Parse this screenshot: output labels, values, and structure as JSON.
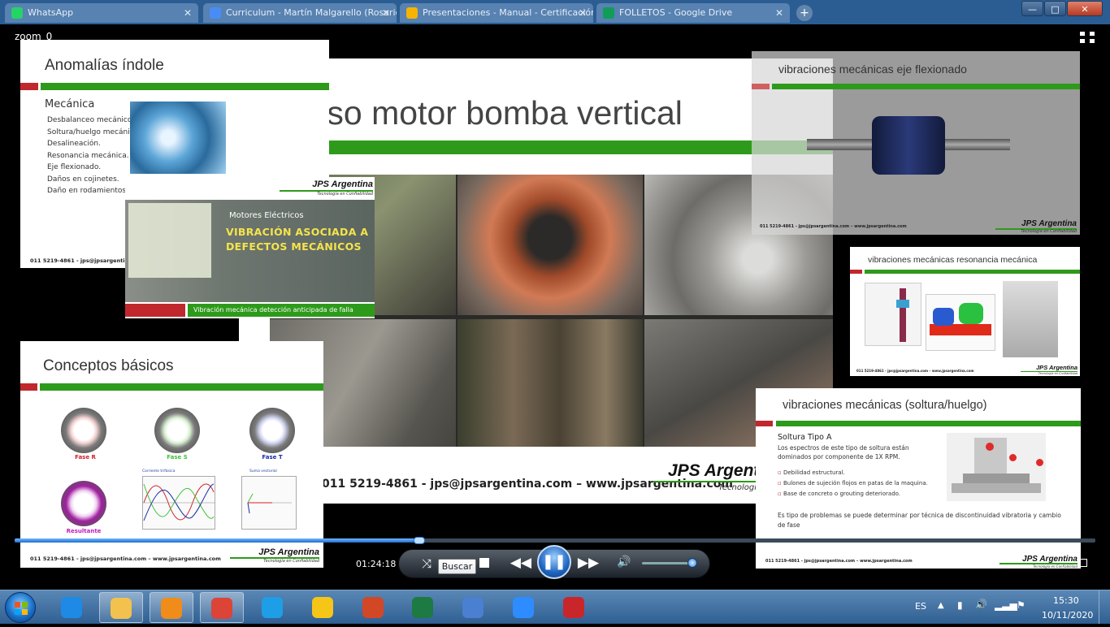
{
  "browser": {
    "tabs": [
      {
        "label": "WhatsApp",
        "icon": "whatsapp-icon",
        "color": "#25d366"
      },
      {
        "label": "Curriculum - Martín Malgarello (Rosario)",
        "icon": "doc-icon",
        "color": "#4a8cf7"
      },
      {
        "label": "Presentaciones - Manual - Certificación",
        "icon": "drive-icon",
        "color": "#f4b400"
      },
      {
        "label": "FOLLETOS - Google Drive",
        "icon": "drive-icon",
        "color": "#0f9d58"
      }
    ],
    "new_tab_label": "+",
    "window_controls": {
      "minimize": "—",
      "maximize": "□",
      "close": "✕"
    }
  },
  "player": {
    "zoom_label": "zoom_0",
    "timecode": "01:24:18",
    "tooltip": "Buscar",
    "progress": 0.37,
    "volume": 0.85
  },
  "slides": {
    "main": {
      "title": "Caso motor bomba vertical",
      "footer": "011 5219-4861  - jps@jpsargentina.com – www.jpsargentina.com",
      "brand": "JPS Argentina",
      "brand_tag": "Tecnología en Confiabilidad"
    },
    "anomalias": {
      "title": "Anomalías índole",
      "section": "Mecánica",
      "bullets": [
        "Desbalanceo mecánico.",
        "Soltura/huelgo mecánico.",
        "Desalineación.",
        "Resonancia mecánica.",
        "Eje flexionado.",
        "Daños en cojinetes.",
        "Daño en rodamientos."
      ],
      "footer": "011 5219-4861  - jps@jpsargentina.co"
    },
    "video_thumb": {
      "brand": "JPS Argentina",
      "brand_tag": "Tecnología en Confiabilidad",
      "subtitle": "Motores Eléctricos",
      "title_line1": "VIBRACIÓN ASOCIADA A",
      "title_line2": "DEFECTOS MECÁNICOS",
      "banner": "Vibración mecánica detección anticipada de falla"
    },
    "conceptos": {
      "title": "Conceptos básicos",
      "phases": [
        {
          "label": "Fase R",
          "color": "#d0202a"
        },
        {
          "label": "Fase S",
          "color": "#3fc23a"
        },
        {
          "label": "Fase T",
          "color": "#1c2fa8"
        },
        {
          "label": "Resultante",
          "color": "#c21bc2"
        }
      ],
      "plot1_title": "Corriente trifásica",
      "plot2_title": "Suma vectorial",
      "footer": "011 5219-4861  - jps@jpsargentina.com – www.jpsargentina.com",
      "brand": "JPS Argentina",
      "brand_tag": "Tecnología en Confiabilidad"
    },
    "eje": {
      "title": "vibraciones mecánicas eje flexionado",
      "footer": "011 5219-4861  - jps@jpsargentina.com – www.jpsargentina.com",
      "brand": "JPS Argentina",
      "brand_tag": "Tecnología en Confiabilidad"
    },
    "resonancia": {
      "title": "vibraciones mecánicas resonancia mecánica",
      "footer": "011 5219-4861  - jps@jpsargentina.com – www.jpsargentina.com",
      "brand": "JPS Argentina",
      "brand_tag": "Tecnología en Confiabilidad"
    },
    "soltura": {
      "title": "vibraciones mecánicas (soltura/huelgo)",
      "subtitle": "Soltura Tipo A",
      "intro": "Los espectros de este tipo de soltura están dominados por componente de 1X RPM.",
      "bullets": [
        "Debilidad estructural.",
        "Bulones de sujeción flojos  en patas de la maquina.",
        "Base de concreto o grouting deteriorado."
      ],
      "note": "Es tipo de problemas se puede determinar por  técnica de discontinuidad vibratoria y cambio de fase",
      "footer": "011 5219-4861  - jps@jpsargentina.com – www.jpsargentina.com",
      "brand": "JPS Argentina",
      "brand_tag": "Tecnología en Confiabilidad"
    }
  },
  "taskbar": {
    "apps": [
      {
        "name": "internet-explorer-icon",
        "color": "#1e8ae6"
      },
      {
        "name": "file-explorer-icon",
        "color": "#f2c14e"
      },
      {
        "name": "media-player-icon",
        "color": "#f08c1a"
      },
      {
        "name": "chrome-icon",
        "color": "#db4437"
      },
      {
        "name": "edge-icon",
        "color": "#1f9ee8"
      },
      {
        "name": "winamp-icon",
        "color": "#f5c518"
      },
      {
        "name": "powerpoint-icon",
        "color": "#d24726"
      },
      {
        "name": "excel-icon",
        "color": "#1d7a43"
      },
      {
        "name": "remote-desktop-icon",
        "color": "#4a7fd1"
      },
      {
        "name": "zoom-icon",
        "color": "#2d8cff"
      },
      {
        "name": "pdf-icon",
        "color": "#c8262b"
      }
    ],
    "language": "ES",
    "time": "15:30",
    "date": "10/11/2020"
  }
}
